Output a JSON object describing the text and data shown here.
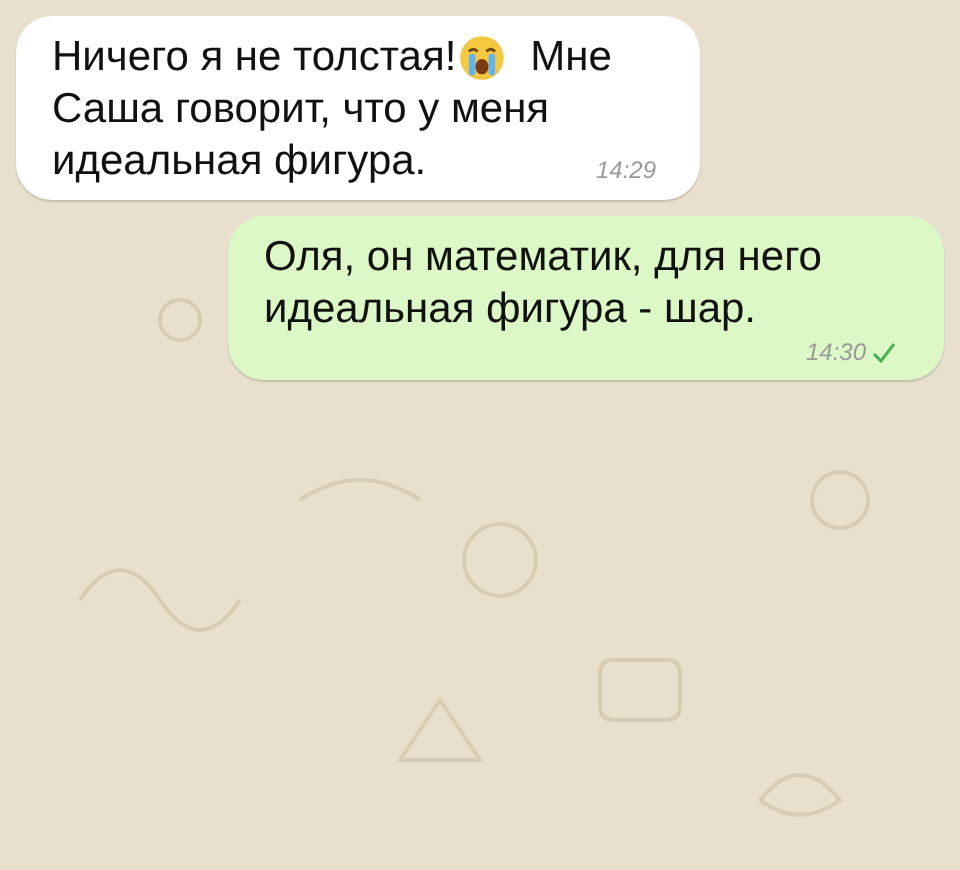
{
  "messages": [
    {
      "outgoing": false,
      "lines": [
        [
          {
            "kind": "text",
            "text": "Ничего я не толстая!"
          },
          {
            "kind": "emoji"
          },
          {
            "kind": "text",
            "text": "Мне"
          }
        ],
        [
          {
            "kind": "text",
            "text": "Саша говорит, что у меня"
          }
        ],
        [
          {
            "kind": "text",
            "text": "идеальная фигура."
          }
        ]
      ],
      "time": "14:29"
    },
    {
      "outgoing": true,
      "lines": [
        [
          {
            "kind": "text",
            "text": "Оля, он математик, для него"
          }
        ],
        [
          {
            "kind": "text",
            "text": "идеальная фигура - шар."
          }
        ]
      ],
      "time": "14:30",
      "delivered": true
    }
  ]
}
